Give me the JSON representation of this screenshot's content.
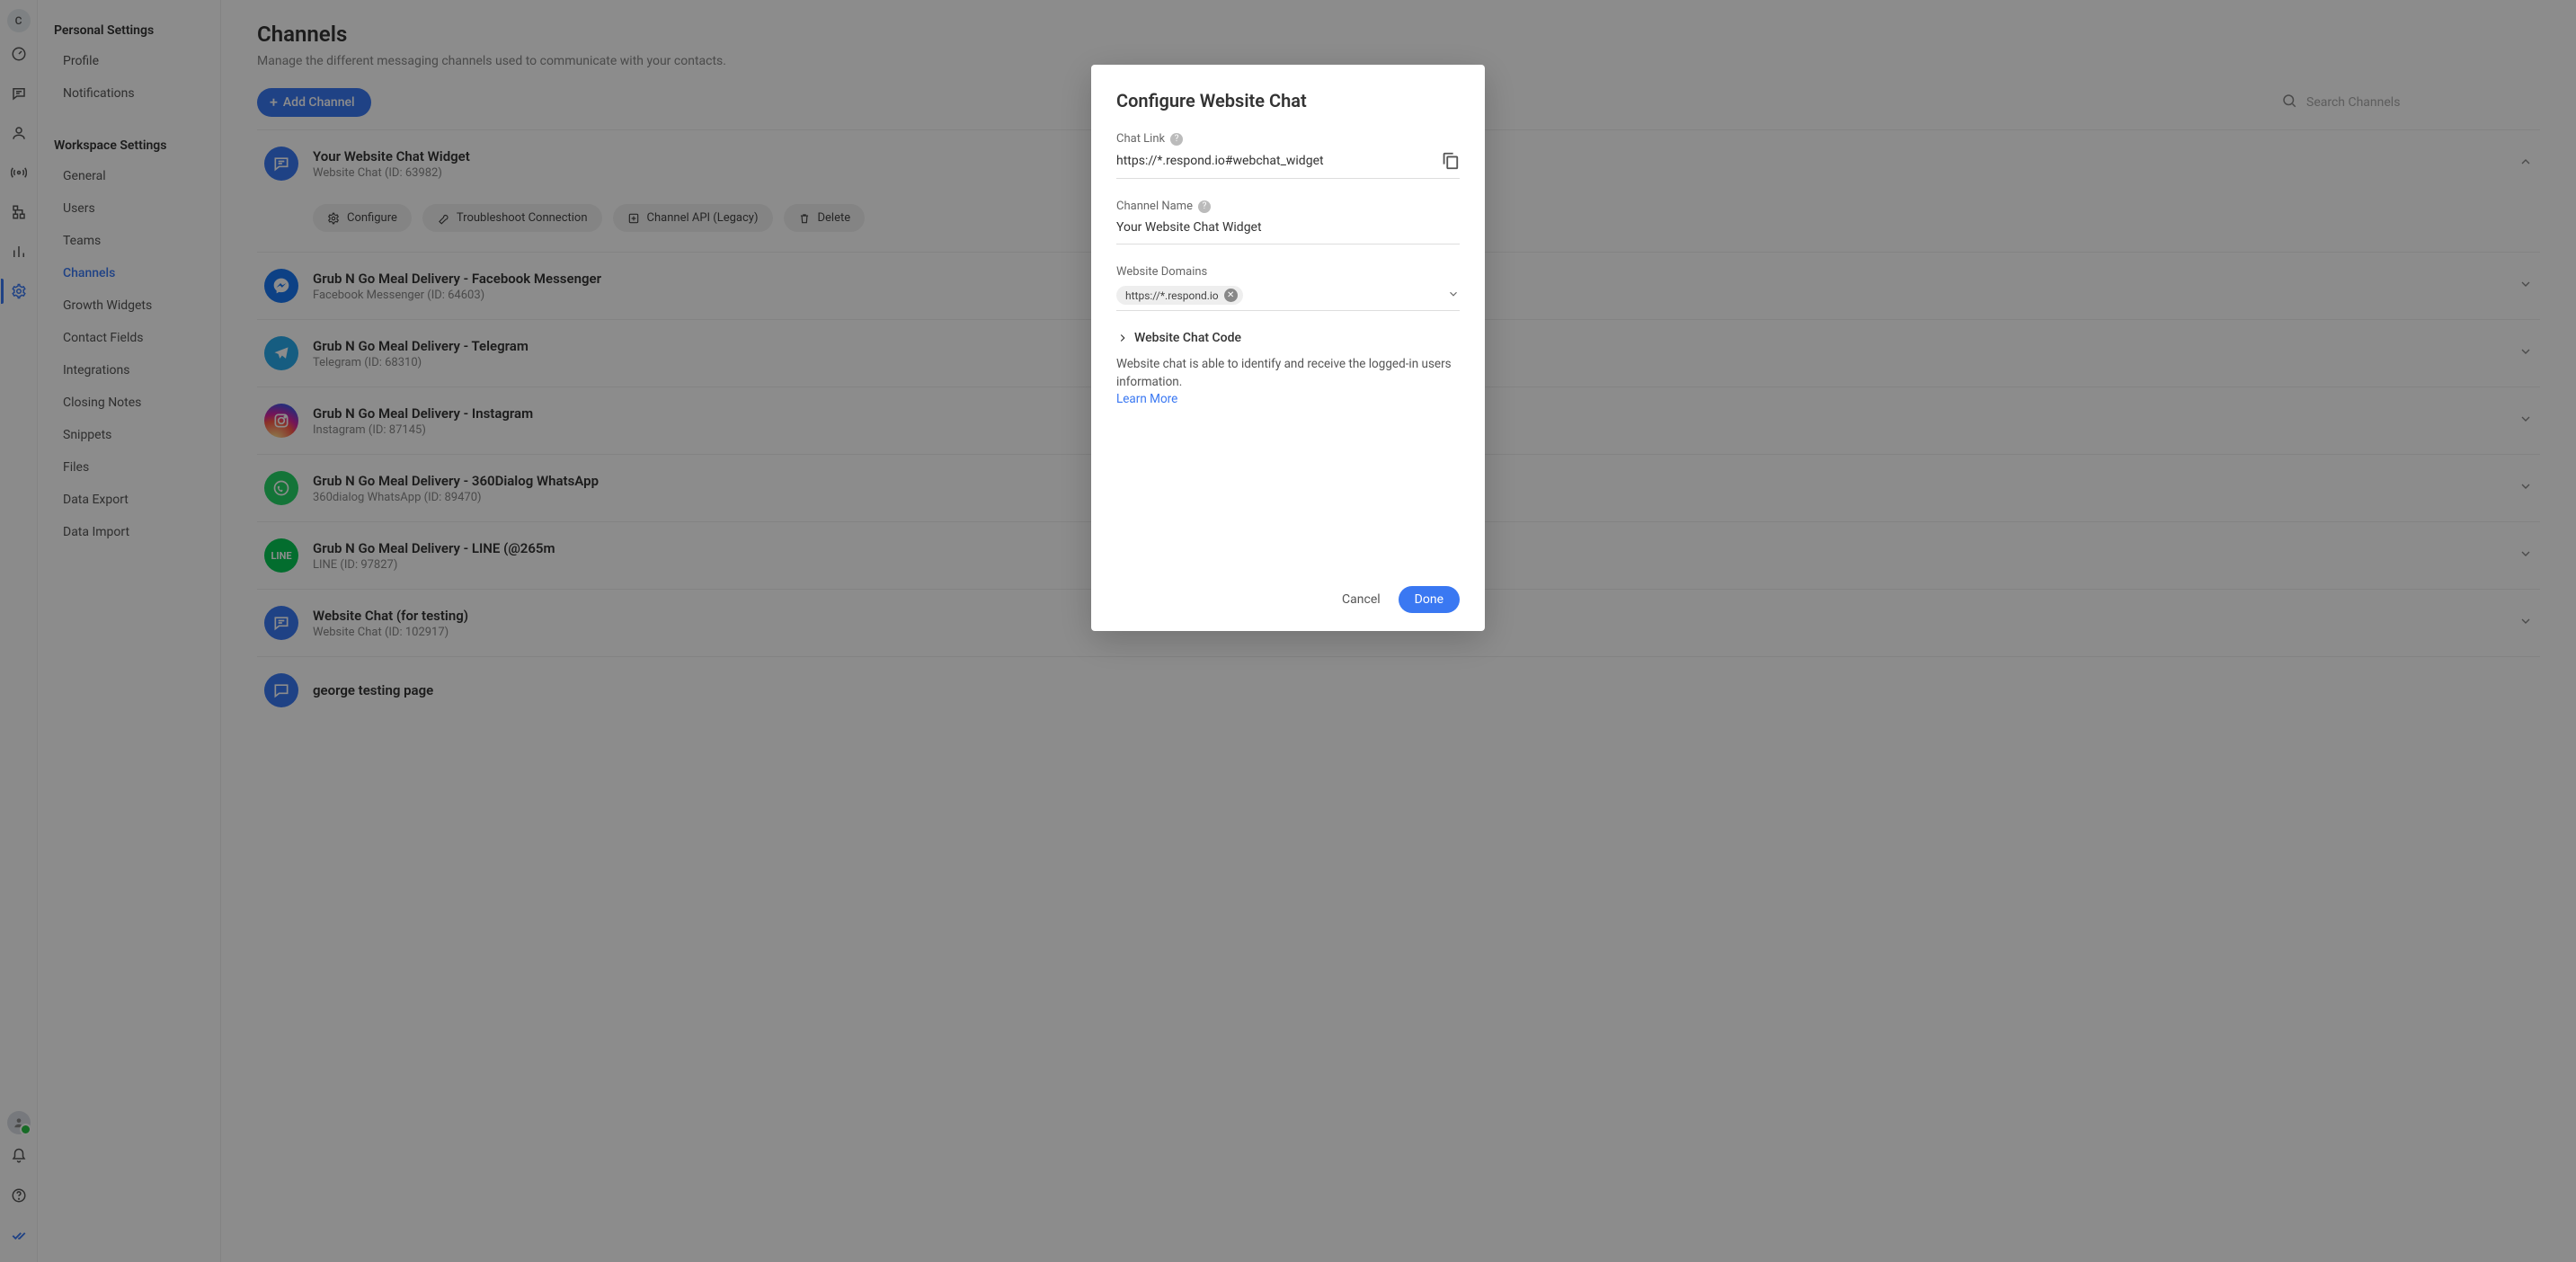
{
  "rail": {
    "avatar_letter": "C"
  },
  "sidebar": {
    "personal_title": "Personal Settings",
    "personal_items": [
      "Profile",
      "Notifications"
    ],
    "workspace_title": "Workspace Settings",
    "workspace_items": [
      "General",
      "Users",
      "Teams",
      "Channels",
      "Growth Widgets",
      "Contact Fields",
      "Integrations",
      "Closing Notes",
      "Snippets",
      "Files",
      "Data Export",
      "Data Import"
    ],
    "active_workspace_index": 3
  },
  "page": {
    "title": "Channels",
    "subtitle": "Manage the different messaging channels used to communicate with your contacts.",
    "add_button": "Add Channel",
    "search_placeholder": "Search Channels"
  },
  "channels": [
    {
      "icon": "chat",
      "title": "Your Website Chat Widget",
      "sub": "Website Chat (ID: 63982)",
      "expanded": true
    },
    {
      "icon": "fb",
      "title": "Grub N Go Meal Delivery - Facebook Messenger",
      "sub": "Facebook Messenger (ID: 64603)",
      "expanded": false
    },
    {
      "icon": "tg",
      "title": "Grub N Go Meal Delivery - Telegram",
      "sub": "Telegram (ID: 68310)",
      "expanded": false
    },
    {
      "icon": "ig",
      "title": "Grub N Go Meal Delivery - Instagram",
      "sub": "Instagram (ID: 87145)",
      "expanded": false
    },
    {
      "icon": "wa",
      "title": "Grub N Go Meal Delivery - 360Dialog WhatsApp",
      "sub": "360dialog WhatsApp (ID: 89470)",
      "expanded": false
    },
    {
      "icon": "line",
      "title": "Grub N Go Meal Delivery - LINE (@265m",
      "sub": "LINE (ID: 97827)",
      "expanded": false
    },
    {
      "icon": "chat",
      "title": "Website Chat (for testing)",
      "sub": "Website Chat (ID: 102917)",
      "expanded": false
    },
    {
      "icon": "chat",
      "title": "george testing page",
      "sub": "",
      "expanded": false
    }
  ],
  "channel_actions": {
    "configure": "Configure",
    "troubleshoot": "Troubleshoot Connection",
    "channel_api": "Channel API (Legacy)",
    "delete": "Delete"
  },
  "modal": {
    "title": "Configure Website Chat",
    "chat_link_label": "Chat Link",
    "chat_link_value": "https://*.respond.io#webchat_widget",
    "channel_name_label": "Channel Name",
    "channel_name_value": "Your Website Chat Widget",
    "domains_label": "Website Domains",
    "domain_chip": "https://*.respond.io",
    "code_expander": "Website Chat Code",
    "info_text": "Website chat is able to identify and receive the logged-in users information.",
    "learn_more": "Learn More",
    "cancel": "Cancel",
    "done": "Done"
  }
}
